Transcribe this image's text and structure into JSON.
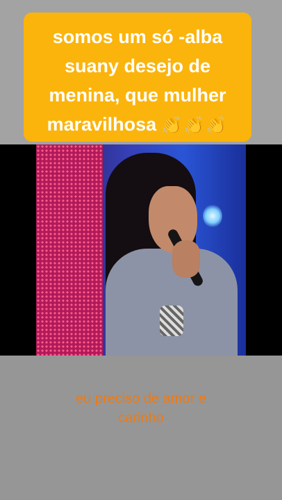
{
  "caption": {
    "line1": "somos um só -alba",
    "line2": "suany desejo de",
    "line3": "menina, que mulher",
    "line4": "maravilhosa",
    "emoji": "👏👏👏"
  },
  "video": {
    "description_icon": "singer-performing"
  },
  "subtitle": {
    "line1": "eu preciso de amor e",
    "line2": "carinho"
  },
  "colors": {
    "caption_bg": "#fbb40c",
    "caption_text": "#ffffff",
    "subtitle_text": "#f07a10",
    "page_bg": "#9a9a9a"
  }
}
